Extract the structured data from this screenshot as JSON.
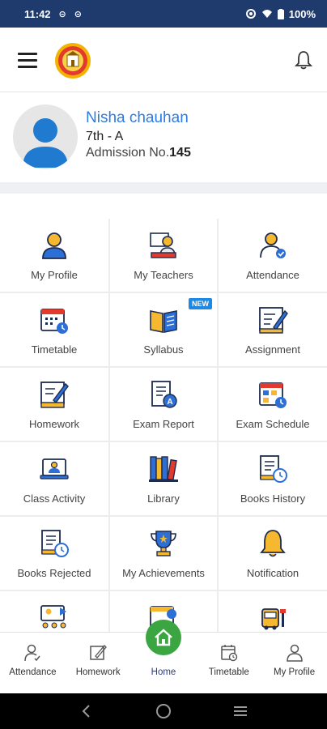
{
  "status_bar": {
    "time": "11:42",
    "notif_icons": [
      "sim-icon",
      "sim-icon"
    ],
    "battery": "100%"
  },
  "app_bar": {
    "logo_name": "school-logo",
    "menu_icon": "menu-icon",
    "bell_icon": "bell-icon"
  },
  "profile": {
    "name": "Nisha chauhan",
    "class": "7th - A",
    "admission_label": "Admission No.",
    "admission_no": "145"
  },
  "tiles": [
    {
      "label": "My Profile",
      "icon": "profile-icon"
    },
    {
      "label": "My Teachers",
      "icon": "teacher-icon"
    },
    {
      "label": "Attendance",
      "icon": "attendance-icon"
    },
    {
      "label": "Timetable",
      "icon": "timetable-icon"
    },
    {
      "label": "Syllabus",
      "icon": "syllabus-icon",
      "badge": "NEW"
    },
    {
      "label": "Assignment",
      "icon": "assignment-icon"
    },
    {
      "label": "Homework",
      "icon": "homework-icon"
    },
    {
      "label": "Exam Report",
      "icon": "exam-report-icon"
    },
    {
      "label": "Exam Schedule",
      "icon": "exam-schedule-icon"
    },
    {
      "label": "Class Activity",
      "icon": "class-activity-icon"
    },
    {
      "label": "Library",
      "icon": "library-icon"
    },
    {
      "label": "Books History",
      "icon": "books-history-icon"
    },
    {
      "label": "Books Rejected",
      "icon": "books-rejected-icon"
    },
    {
      "label": "My Achievements",
      "icon": "trophy-icon"
    },
    {
      "label": "Notification",
      "icon": "notification-bell-icon"
    },
    {
      "label": "",
      "icon": "video-class-icon"
    },
    {
      "label": "",
      "icon": "event-calendar-icon"
    },
    {
      "label": "",
      "icon": "bus-icon"
    }
  ],
  "bottom_nav": [
    {
      "label": "Attendance",
      "icon": "attendance-nav-icon"
    },
    {
      "label": "Homework",
      "icon": "homework-nav-icon"
    },
    {
      "label": "Home",
      "icon": "home-icon"
    },
    {
      "label": "Timetable",
      "icon": "timetable-nav-icon"
    },
    {
      "label": "My Profile",
      "icon": "profile-nav-icon"
    }
  ],
  "colors": {
    "status_bar": "#1f3b6e",
    "accent_blue": "#2c7be5",
    "home_green": "#3aa541"
  }
}
